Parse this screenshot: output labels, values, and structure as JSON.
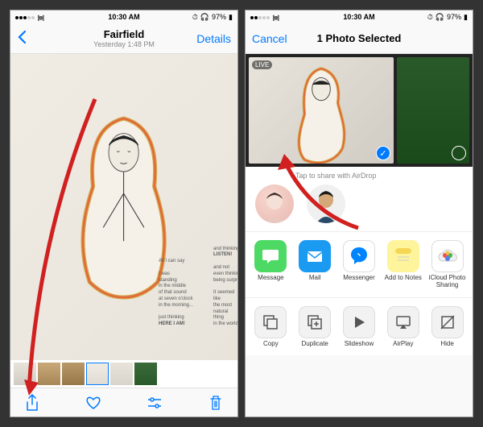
{
  "status": {
    "carrier": "ooooo",
    "time": "10:30 AM",
    "battery": "97%"
  },
  "left": {
    "title": "Fairfield",
    "subtitle": "Yesterday 1:48 PM",
    "details": "Details",
    "toolbar": {
      "share": "Share",
      "favorite": "Favorite",
      "edit": "Edit",
      "delete": "Delete"
    }
  },
  "right": {
    "cancel": "Cancel",
    "title": "1 Photo Selected",
    "live_badge": "LIVE",
    "airdrop_label": "Tap to share with AirDrop",
    "apps": [
      {
        "label": "Message",
        "color": "#4cd964",
        "glyph": "msg"
      },
      {
        "label": "Mail",
        "color": "#1a9af0",
        "glyph": "mail"
      },
      {
        "label": "Messenger",
        "color": "#fff",
        "glyph": "fbm"
      },
      {
        "label": "Add to Notes",
        "color": "#fef49c",
        "glyph": "notes"
      },
      {
        "label": "iCloud Photo Sharing",
        "color": "#fff",
        "glyph": "cloud"
      }
    ],
    "actions": [
      {
        "label": "Copy"
      },
      {
        "label": "Duplicate"
      },
      {
        "label": "Slideshow"
      },
      {
        "label": "AirPlay"
      },
      {
        "label": "Hide"
      }
    ]
  }
}
